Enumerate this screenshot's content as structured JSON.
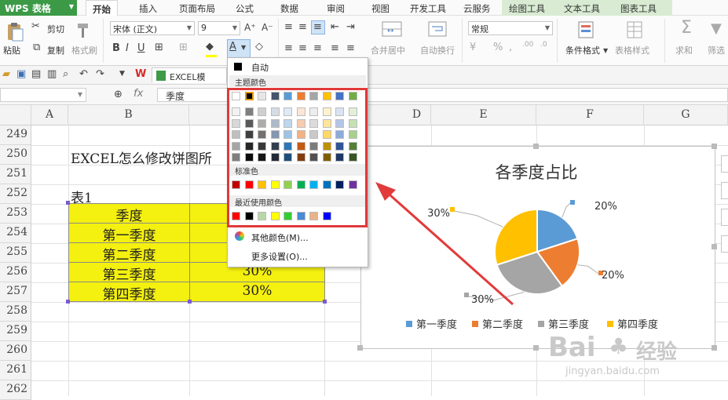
{
  "app": {
    "name": "WPS 表格"
  },
  "menu": {
    "tabs": [
      "开始",
      "插入",
      "页面布局",
      "公式",
      "数据",
      "审阅",
      "视图",
      "开发工具",
      "云服务",
      "绘图工具",
      "文本工具",
      "图表工具"
    ],
    "active": "开始"
  },
  "ribbon": {
    "paste": "粘贴",
    "cut": "剪切",
    "copy": "复制",
    "format_painter": "格式刷",
    "font_name": "宋体 (正文)",
    "font_size": "9",
    "number_format": "常规",
    "merge_center": "合并居中",
    "wrap_text": "自动换行",
    "conditional_format": "条件格式",
    "table_style": "表格样式",
    "sum": "求和",
    "filter": "筛选"
  },
  "document": {
    "tab_name": "EXCEL模板.xls"
  },
  "formula_bar": {
    "value": "季度"
  },
  "columns": [
    "A",
    "B",
    "C",
    "D",
    "E",
    "F",
    "G"
  ],
  "rows": [
    "249",
    "250",
    "251",
    "252",
    "253",
    "254",
    "255",
    "256",
    "257",
    "258",
    "259",
    "260",
    "261",
    "262"
  ],
  "sheet": {
    "heading": "EXCEL怎么修改饼图所",
    "table_label": "表1",
    "header_quarter": "季度",
    "quarters": [
      "第一季度",
      "第二季度",
      "第三季度",
      "第四季度"
    ],
    "values": [
      "30%",
      "30%"
    ]
  },
  "color_panel": {
    "auto": "自动",
    "theme_title": "主题颜色",
    "theme_top": [
      "#ffffff",
      "#000000",
      "#e7e6e6",
      "#44546a",
      "#5b9bd5",
      "#ed7d31",
      "#a5a5a5",
      "#ffc000",
      "#4472c4",
      "#70ad47"
    ],
    "theme_shades": [
      [
        "#f2f2f2",
        "#7f7f7f",
        "#d0cece",
        "#d6dce4",
        "#deebf6",
        "#fbe5d5",
        "#ededed",
        "#fff2cc",
        "#dae3f3",
        "#e2efd9"
      ],
      [
        "#d8d8d8",
        "#595959",
        "#aeabab",
        "#adb9ca",
        "#bdd7ee",
        "#f7cbac",
        "#dbdbdb",
        "#fee599",
        "#b4c6e7",
        "#c5e0b3"
      ],
      [
        "#bfbfbf",
        "#3f3f3f",
        "#757070",
        "#8496b0",
        "#9dc3e6",
        "#f4b183",
        "#c9c9c9",
        "#ffd965",
        "#8eaadb",
        "#a8d08d"
      ],
      [
        "#a5a5a5",
        "#262626",
        "#3a3838",
        "#323f4f",
        "#2e75b5",
        "#c55a11",
        "#7b7b7b",
        "#bf9000",
        "#2f5496",
        "#538135"
      ],
      [
        "#7f7f7f",
        "#0c0c0c",
        "#171616",
        "#222a35",
        "#1e4e79",
        "#833c0b",
        "#525252",
        "#7f6000",
        "#1f3864",
        "#375623"
      ]
    ],
    "standard_title": "标准色",
    "standard": [
      "#c00000",
      "#ff0000",
      "#ffc000",
      "#ffff00",
      "#92d050",
      "#00b050",
      "#00b0f0",
      "#0070c0",
      "#002060",
      "#7030a0"
    ],
    "recent_title": "最近使用颜色",
    "recent": [
      "#ff0000",
      "#000000",
      "#b7d7a8",
      "#ffff00",
      "#32cd32",
      "#4a8bd4",
      "#e9b38a",
      "#0000ff"
    ],
    "more_colors": "其他颜色(M)...",
    "more_settings": "更多设置(O)..."
  },
  "chart_data": {
    "type": "pie",
    "title": "各季度占比",
    "categories": [
      "第一季度",
      "第二季度",
      "第三季度",
      "第四季度"
    ],
    "values": [
      20,
      20,
      30,
      30
    ],
    "labels": [
      "20%",
      "20%",
      "30%",
      "30%"
    ],
    "colors": [
      "#5b9bd5",
      "#ed7d31",
      "#a5a5a5",
      "#ffc000"
    ],
    "legend_position": "bottom"
  },
  "watermark": {
    "brand": "Bai",
    "brand2": "经验",
    "url": "jingyan.baidu.com"
  }
}
